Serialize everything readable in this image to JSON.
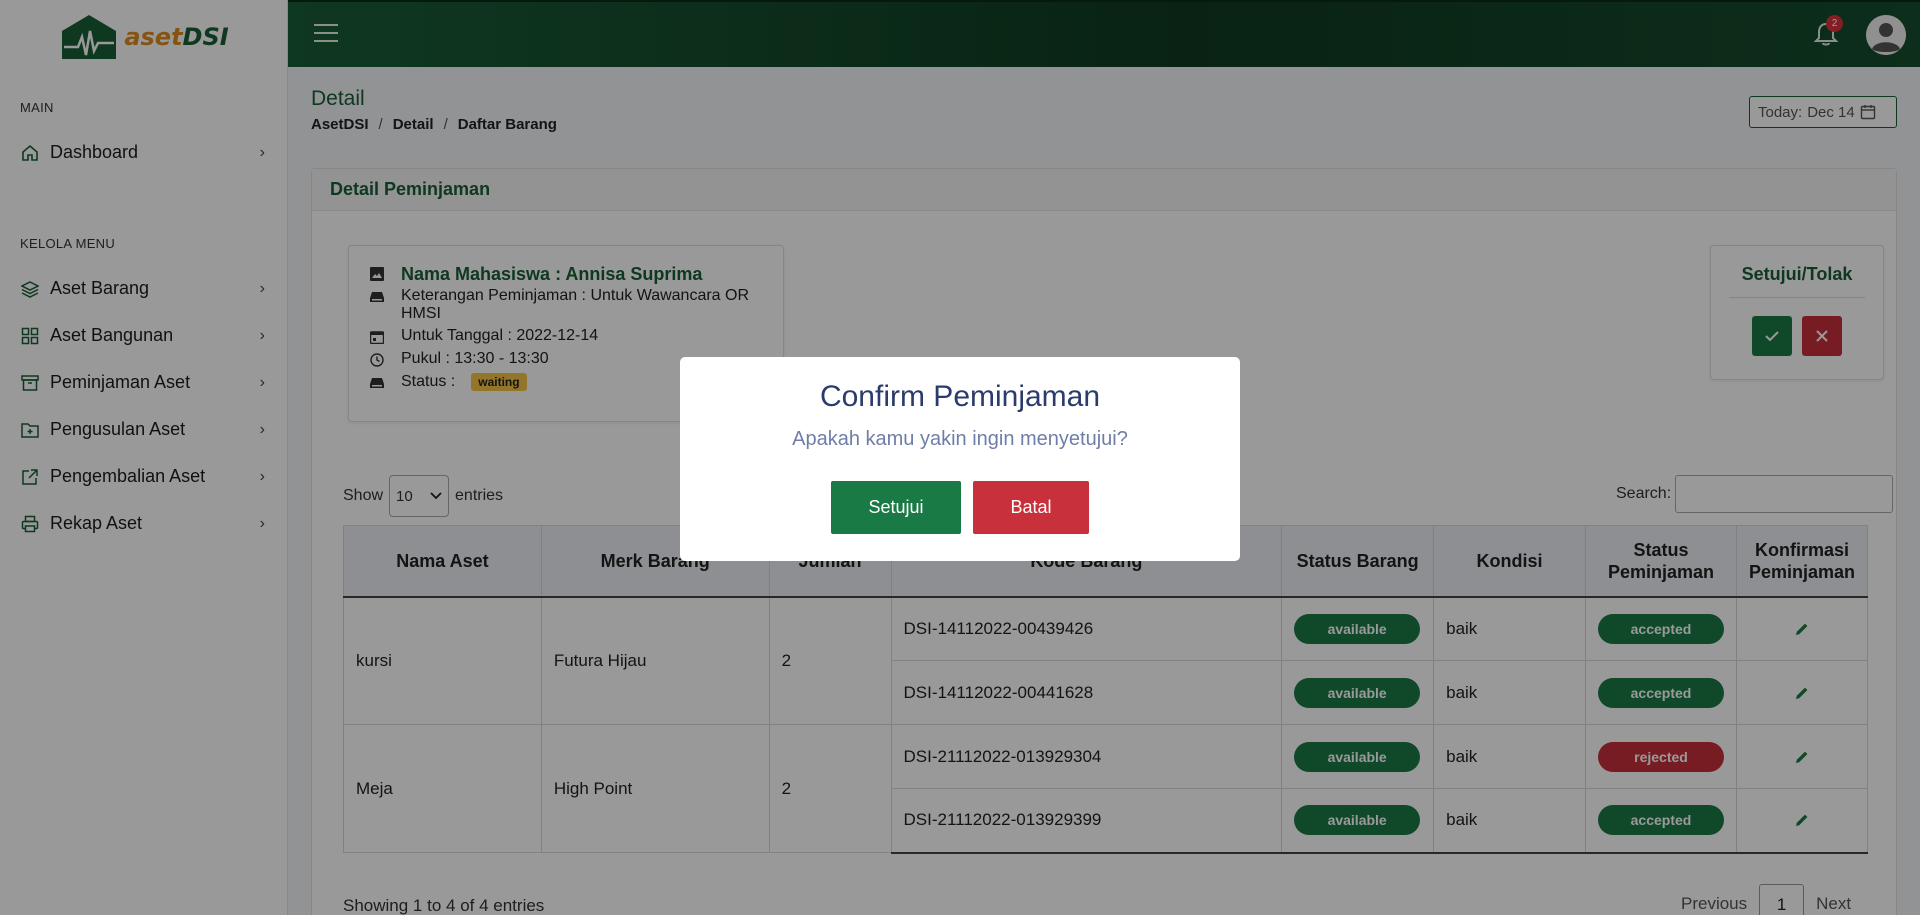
{
  "app": {
    "logo_text_a": "aset",
    "logo_text_b": "DSI"
  },
  "sidebar": {
    "main_heading": "MAIN",
    "dashboard": "Dashboard",
    "kelola_heading": "KELOLA MENU",
    "items": [
      {
        "label": "Aset Barang",
        "icon": "layers-icon"
      },
      {
        "label": "Aset Bangunan",
        "icon": "grid-icon"
      },
      {
        "label": "Peminjaman Aset",
        "icon": "archive-icon"
      },
      {
        "label": "Pengusulan Aset",
        "icon": "folder-plus-icon"
      },
      {
        "label": "Pengembalian Aset",
        "icon": "external-link-icon"
      },
      {
        "label": "Rekap Aset",
        "icon": "printer-icon"
      }
    ]
  },
  "topbar": {
    "notification_count": "2"
  },
  "header": {
    "title": "Detail",
    "breadcrumb": [
      "AsetDSI",
      "Detail",
      "Daftar Barang"
    ],
    "today_label": "Today:",
    "today_value": "Dec 14"
  },
  "card": {
    "title": "Detail Peminjaman"
  },
  "info": {
    "name": "Nama Mahasiswa : Annisa Suprima",
    "keterangan": "Keterangan Peminjaman : Untuk Wawancara OR HMSI",
    "tanggal": "Untuk Tanggal : 2022-12-14",
    "pukul": "Pukul : 13:30 - 13:30",
    "status_label": "Status :",
    "status_value": "waiting"
  },
  "approve": {
    "title": "Setujui/Tolak"
  },
  "table_controls": {
    "show_label": "Show",
    "entries_value": "10",
    "entries_label": "entries",
    "search_label": "Search:"
  },
  "table": {
    "headers": [
      "Nama Aset",
      "Merk Barang",
      "Jumlah",
      "Kode Barang",
      "Status Barang",
      "Kondisi",
      "Status Peminjaman",
      "Konfirmasi Peminjaman"
    ],
    "groups": [
      {
        "nama": "kursi",
        "merk": "Futura Hijau",
        "jumlah": "2",
        "items": [
          {
            "kode": "DSI-14112022-00439426",
            "status_barang": "available",
            "kondisi": "baik",
            "status_peminjaman": "accepted"
          },
          {
            "kode": "DSI-14112022-00441628",
            "status_barang": "available",
            "kondisi": "baik",
            "status_peminjaman": "accepted"
          }
        ]
      },
      {
        "nama": "Meja",
        "merk": "High Point",
        "jumlah": "2",
        "items": [
          {
            "kode": "DSI-21112022-013929304",
            "status_barang": "available",
            "kondisi": "baik",
            "status_peminjaman": "rejected"
          },
          {
            "kode": "DSI-21112022-013929399",
            "status_barang": "available",
            "kondisi": "baik",
            "status_peminjaman": "accepted"
          }
        ]
      }
    ]
  },
  "footer": {
    "showing": "Showing 1 to 4 of 4 entries",
    "previous": "Previous",
    "page": "1",
    "next": "Next"
  },
  "modal": {
    "title": "Confirm Peminjaman",
    "text": "Apakah kamu yakin ingin menyetujui?",
    "ok": "Setujui",
    "cancel": "Batal"
  },
  "colors": {
    "brand_green": "#1a5e36",
    "accent_green": "#1a7a45",
    "danger_red": "#c8303b",
    "warning_yellow": "#f6c545"
  }
}
